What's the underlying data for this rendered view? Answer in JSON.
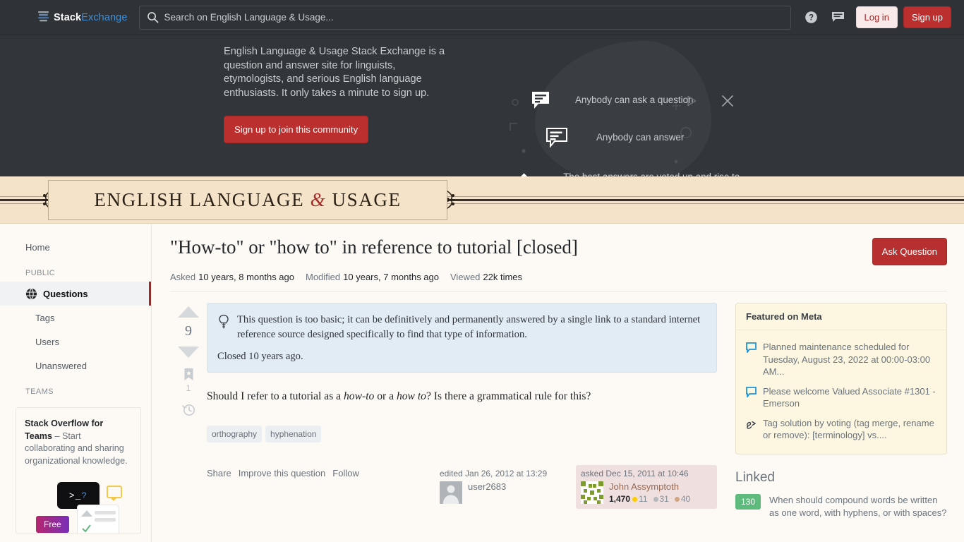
{
  "topnav": {
    "logo_stack": "Stack",
    "logo_exchange": "Exchange",
    "search_placeholder": "Search on English Language & Usage...",
    "search_value": "",
    "help_label": "Help",
    "inbox_label": "Inbox",
    "login_label": "Log in",
    "signup_label": "Sign up"
  },
  "hero": {
    "description": "English Language & Usage Stack Exchange is a question and answer site for linguists, etymologists, and serious English language enthusiasts. It only takes a minute to sign up.",
    "cta_label": "Sign up to join this community",
    "features": [
      "Anybody can ask a question",
      "Anybody can answer",
      "The best answers are voted up and rise to the top"
    ],
    "play_label": "Play video",
    "close_label": "Dismiss"
  },
  "site_banner": {
    "title_pre": "ENGLISH LANGUAGE ",
    "title_amp": "&",
    "title_post": " USAGE"
  },
  "sidebar": {
    "home_label": "Home",
    "public_heading": "PUBLIC",
    "public_items": [
      {
        "label": "Questions",
        "active": true
      },
      {
        "label": "Tags",
        "active": false
      },
      {
        "label": "Users",
        "active": false
      },
      {
        "label": "Unanswered",
        "active": false
      }
    ],
    "teams_heading": "TEAMS",
    "teams_title": "Stack Overflow for Teams",
    "teams_body": " – Start collaborating and sharing organizational knowledge.",
    "teams_terminal": ">_",
    "teams_terminal_q": "?",
    "teams_free": "Free"
  },
  "question": {
    "title": "\"How-to\" or \"how to\" in reference to tutorial [closed]",
    "ask_button": "Ask Question",
    "stats": [
      {
        "label": "Asked",
        "value": "10 years, 8 months ago"
      },
      {
        "label": "Modified",
        "value": "10 years, 7 months ago"
      },
      {
        "label": "Viewed",
        "value": "22k times"
      }
    ],
    "vote_count": "9",
    "bookmark_count": "1",
    "notice_text": "This question is too basic; it can be definitively and permanently answered by a single link to a standard internet reference source designed specifically to find that type of information.",
    "notice_closed": "Closed 10 years ago.",
    "body_pre": "Should I refer to a tutorial as a ",
    "body_em1": "how-to",
    "body_mid": " or a ",
    "body_em2": "how to",
    "body_post": "? Is there a grammatical rule for this?",
    "tags": [
      "orthography",
      "hyphenation"
    ],
    "actions": [
      "Share",
      "Improve this question",
      "Follow"
    ],
    "editor": {
      "time": "edited Jan 26, 2012 at 13:29",
      "name": "user2683"
    },
    "owner": {
      "time": "asked Dec 15, 2011 at 10:46",
      "name": "John Assymptoth",
      "reputation": "1,470",
      "gold": "11",
      "silver": "31",
      "bronze": "40"
    }
  },
  "rail": {
    "featured_title": "Featured on Meta",
    "featured_items": [
      {
        "icon": "speech-bubble-icon",
        "text": "Planned maintenance scheduled for Tuesday, August 23, 2022 at 00:00-03:00 AM..."
      },
      {
        "icon": "speech-bubble-icon",
        "text": "Please welcome Valued Associate #1301 - Emerson"
      },
      {
        "icon": "tag-merge-icon",
        "text": "Tag solution by voting (tag merge, rename or remove): [terminology] vs...."
      }
    ],
    "linked_title": "Linked",
    "linked_items": [
      {
        "score": "130",
        "text": "When should compound words be written as one word, with hyphens, or with spaces?"
      }
    ]
  },
  "colors": {
    "accent_red": "#bb2f2f",
    "banner_tan": "#f4e3c8",
    "link_blue": "#3e8ed8",
    "notice_blue": "#e1ecf4",
    "meta_card": "#fdf7e2",
    "linked_green": "#5eba7d",
    "owner_card": "#f0dfdf"
  }
}
